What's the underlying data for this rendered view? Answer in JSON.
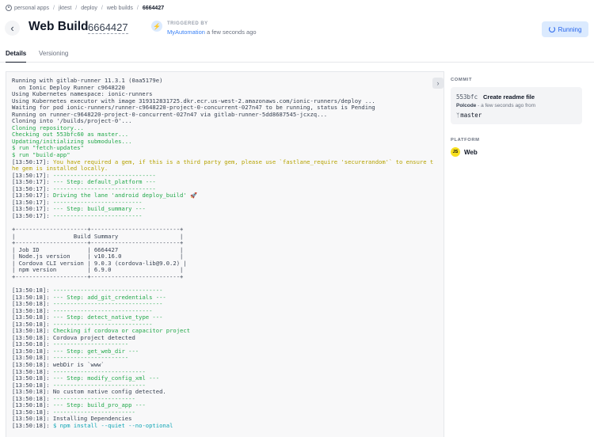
{
  "breadcrumb": [
    "personal apps",
    "jktest",
    "deploy",
    "web builds",
    "6664427"
  ],
  "header": {
    "title": "Web Build",
    "build_number": "6664427",
    "trigger_label": "TRIGGERED BY",
    "trigger_by": "MyAutomation",
    "trigger_time": "a few seconds ago",
    "status": "Running"
  },
  "tabs": [
    "Details",
    "Versioning"
  ],
  "log_lines": [
    {
      "t": "Running with gitlab-runner 11.3.1 (0aa5179e)",
      "c": "d"
    },
    {
      "t": "  on Ionic Deploy Runner c9648220",
      "c": "d"
    },
    {
      "t": "Using Kubernetes namespace: ionic-runners",
      "c": "d"
    },
    {
      "t": "Using Kubernetes executor with image 319312831725.dkr.ecr.us-west-2.amazonaws.com/ionic-runners/deploy ...",
      "c": "d"
    },
    {
      "t": "Waiting for pod ionic-runners/runner-c9648220-project-0-concurrent-027n47 to be running, status is Pending",
      "c": "d"
    },
    {
      "t": "Running on runner-c9648220-project-0-concurrent-027n47 via gitlab-runner-5dd8687545-jcxzq...",
      "c": "d"
    },
    {
      "t": "Cloning into '/builds/project-0'...",
      "c": "d"
    },
    {
      "t": "Cloning repository...",
      "c": "g"
    },
    {
      "t": "Checking out 553bfc60 as master...",
      "c": "g"
    },
    {
      "t": "Updating/initializing submodules...",
      "c": "g"
    },
    {
      "t": "$ run \"fetch-updates\"",
      "c": "g"
    },
    {
      "t": "$ run \"build-app\"",
      "c": "g"
    },
    {
      "t": "[13:50:17]: You have required a gem, if this is a third party gem, please use `fastlane_require 'securerandom'` to ensure t",
      "c": "y",
      "p": 12
    },
    {
      "t": "he gem is installed locally.",
      "c": "y"
    },
    {
      "t": "[13:50:17]: ------------------------------",
      "c": "g",
      "p": 12
    },
    {
      "t": "[13:50:17]: --- Step: default_platform ---",
      "c": "g",
      "p": 12
    },
    {
      "t": "[13:50:17]: ------------------------------",
      "c": "g",
      "p": 12
    },
    {
      "t": "[13:50:17]: Driving the lane 'android deploy_build' 🚀",
      "c": "g",
      "p": 12
    },
    {
      "t": "[13:50:17]: --------------------------",
      "c": "g",
      "p": 12
    },
    {
      "t": "[13:50:17]: --- Step: build_summary ---",
      "c": "g",
      "p": 12
    },
    {
      "t": "[13:50:17]: --------------------------",
      "c": "g",
      "p": 12
    },
    {
      "t": "",
      "c": "d"
    },
    {
      "t": "+---------------------+--------------------------+",
      "c": "d"
    },
    {
      "t": "|                 Build Summary                  |",
      "c": "d"
    },
    {
      "t": "+---------------------+--------------------------+",
      "c": "d"
    },
    {
      "t": "| Job ID              | 6664427                  |",
      "c": "d"
    },
    {
      "t": "| Node.js version     | v10.16.0                 |",
      "c": "d"
    },
    {
      "t": "| Cordova CLI version | 9.0.3 (cordova-lib@9.0.2) |",
      "c": "d"
    },
    {
      "t": "| npm version         | 6.9.0                    |",
      "c": "d"
    },
    {
      "t": "+---------------------+--------------------------+",
      "c": "d"
    },
    {
      "t": "",
      "c": "d"
    },
    {
      "t": "[13:50:18]: --------------------------------",
      "c": "g",
      "p": 12
    },
    {
      "t": "[13:50:18]: --- Step: add_git_credentials ---",
      "c": "g",
      "p": 12
    },
    {
      "t": "[13:50:18]: --------------------------------",
      "c": "g",
      "p": 12
    },
    {
      "t": "[13:50:18]: -----------------------------",
      "c": "g",
      "p": 12
    },
    {
      "t": "[13:50:18]: --- Step: detect_native_type ---",
      "c": "g",
      "p": 12
    },
    {
      "t": "[13:50:18]: -----------------------------",
      "c": "g",
      "p": 12
    },
    {
      "t": "[13:50:18]: Checking if cordova or capacitor project",
      "c": "g",
      "p": 12
    },
    {
      "t": "[13:50:18]: Cordova project detected",
      "c": "d"
    },
    {
      "t": "[13:50:18]: ----------------------",
      "c": "g",
      "p": 12
    },
    {
      "t": "[13:50:18]: --- Step: get_web_dir ---",
      "c": "g",
      "p": 12
    },
    {
      "t": "[13:50:18]: ----------------------",
      "c": "g",
      "p": 12
    },
    {
      "t": "[13:50:18]: webDir is `www`",
      "c": "d"
    },
    {
      "t": "[13:50:18]: ---------------------------",
      "c": "g",
      "p": 12
    },
    {
      "t": "[13:50:18]: --- Step: modify_config_xml ---",
      "c": "g",
      "p": 12
    },
    {
      "t": "[13:50:18]: ---------------------------",
      "c": "g",
      "p": 12
    },
    {
      "t": "[13:50:18]: No custom native config detected.",
      "c": "d"
    },
    {
      "t": "[13:50:18]: ------------------------",
      "c": "g",
      "p": 12
    },
    {
      "t": "[13:50:18]: --- Step: build_pro_app ---",
      "c": "g",
      "p": 12
    },
    {
      "t": "[13:50:18]: ------------------------",
      "c": "g",
      "p": 12
    },
    {
      "t": "[13:50:18]: Installing Dependencies",
      "c": "d"
    },
    {
      "t": "[13:50:18]: $ npm install --quiet --no-optional",
      "c": "c",
      "p": 12
    }
  ],
  "sidebar": {
    "commit_heading": "COMMIT",
    "commit_sha": "553bfc",
    "commit_message": "Create readme file",
    "commit_author": "Polcode",
    "commit_time": "- a few seconds ago from",
    "commit_branch": "master",
    "platform_heading": "PLATFORM",
    "platform_badge": "JS",
    "platform_name": "Web"
  },
  "icons": {
    "breadcrumb": "personal-apps-icon",
    "back": "chevron-left-icon",
    "trigger": "lightning-icon",
    "status": "spinner-icon",
    "expand": "chevron-right-icon",
    "branch": "branch-icon"
  },
  "colors": {
    "accent": "#2563eb",
    "log_green": "#22a84a",
    "log_yellow": "#b5a200",
    "log_cyan": "#0ea5b5",
    "js_badge": "#f7df1e"
  }
}
